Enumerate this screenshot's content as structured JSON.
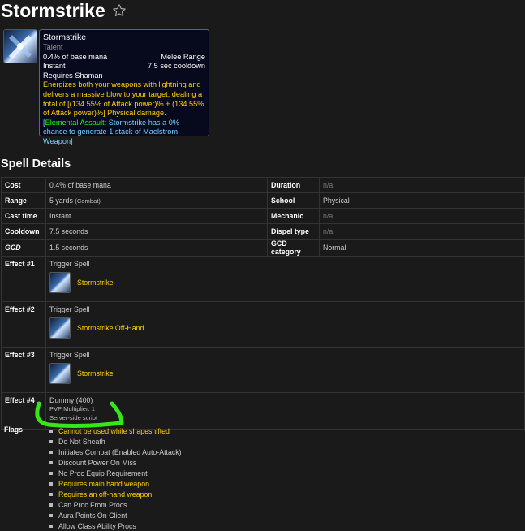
{
  "page": {
    "title": "Stormstrike",
    "favorite_icon": "star-outline-icon"
  },
  "tooltip": {
    "name": "Stormstrike",
    "type": "Talent",
    "cost": "0.4% of base mana",
    "range": "Melee Range",
    "cast": "Instant",
    "cooldown": "7.5 sec cooldown",
    "requires": "Requires Shaman",
    "description": "Energizes both your weapons with lightning and delivers a massive blow to your target, dealing a total of [(134.55% of Attack power)% + (134.55% of Attack power)%] Physical damage.",
    "extra_open": "[",
    "extra_green": "Elemental Assault",
    "extra_blue": ": Stormstrike has a 0% chance to generate 1 stack of Maelstrom Weapon",
    "extra_close": "]"
  },
  "section_title": "Spell Details",
  "details": {
    "cost_label": "Cost",
    "cost_value": "0.4% of base mana",
    "range_label": "Range",
    "range_value": "5 yards",
    "range_note": "(Combat)",
    "cast_label": "Cast time",
    "cast_value": "Instant",
    "cooldown_label": "Cooldown",
    "cooldown_value": "7.5 seconds",
    "gcd_label": "GCD",
    "gcd_value": "1.5 seconds",
    "duration_label": "Duration",
    "duration_value": "n/a",
    "school_label": "School",
    "school_value": "Physical",
    "mechanic_label": "Mechanic",
    "mechanic_value": "n/a",
    "dispel_label": "Dispel type",
    "dispel_value": "n/a",
    "gcd_cat_label": "GCD category",
    "gcd_cat_value": "Normal"
  },
  "effects": [
    {
      "label": "Effect #1",
      "type": "Trigger Spell",
      "spell": "Stormstrike"
    },
    {
      "label": "Effect #2",
      "type": "Trigger Spell",
      "spell": "Stormstrike Off-Hand"
    },
    {
      "label": "Effect #3",
      "type": "Trigger Spell",
      "spell": "Stormstrike"
    },
    {
      "label": "Effect #4",
      "type": "Dummy (400)",
      "pvp": "PVP Multiplier: 1",
      "note": "Server-side script"
    }
  ],
  "flags_label": "Flags",
  "flags": [
    "Cannot be used while shapeshifted",
    "Do Not Sheath",
    "Initiates Combat (Enabled Auto-Attack)",
    "Discount Power On Miss",
    "No Proc Equip Requirement",
    "Requires main hand weapon",
    "Requires an off-hand weapon",
    "Can Proc From Procs",
    "Aura Points On Client",
    "Allow Class Ability Procs"
  ],
  "colors": {
    "gold": "#ffd100",
    "green": "#1eff00",
    "blue": "#71d5ff",
    "annotation": "#37e619"
  }
}
